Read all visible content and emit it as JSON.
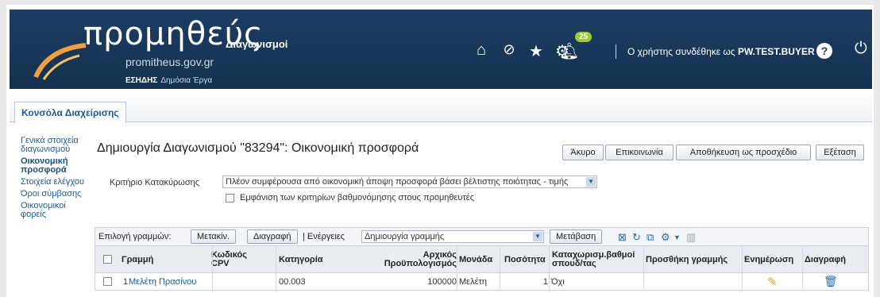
{
  "header": {
    "logo_main": "προμηθεύς",
    "logo_suffix": "Διαγωνισμοί",
    "logo_domain": "promitheus.gov.gr",
    "logo_org": "ΕΣΗΔΗΣ",
    "logo_org_sub": "Δημόσια Έργα",
    "icons": [
      "home-icon",
      "no-entry-icon",
      "star-icon",
      "gear-icon",
      "bell-icon"
    ],
    "notifications": "25",
    "user_prefix": "Ο χρήστης συνδέθηκε ως",
    "user_name": "PW.TEST.BUYER",
    "help": "?",
    "power": "⏻"
  },
  "tabs": {
    "active": "Κονσόλα Διαχείρισης"
  },
  "sidebar": {
    "items": [
      {
        "label": "Γενικά στοιχεία διαγωνισμού"
      },
      {
        "label": "Οικονομική προσφορά"
      },
      {
        "label": "Στοιχεία ελέγχου"
      },
      {
        "label": "Όροι σύμβασης"
      },
      {
        "label": "Οικονομικοί φορείς"
      }
    ]
  },
  "page": {
    "title": "Δημιουργία Διαγωνισμού \"83294\": Οικονομική προσφορά",
    "buttons": {
      "cancel": "Άκυρο",
      "communication": "Επικοινωνία",
      "save_draft": "Αποθήκευση ως προσχέδιο",
      "review": "Εξέταση"
    },
    "criterion_label": "Κριτήριο Κατακύρωσης",
    "criterion_value": "Πλέον συμφέρουσα από οικονομική άποψη προσφορά βάσει βέλτιστης ποιότητας - τιμής",
    "show_criteria_label": "Εμφάνιση των κριτηρίων βαθμονόμησης στους προμηθευτές"
  },
  "toolbar": {
    "select_rows": "Επιλογή γραμμών:",
    "move": "Μετακίν.",
    "delete": "Διαγραφή",
    "actions": "| Ενέργειες",
    "action_value": "Δημιουργία γραμμής",
    "go": "Μετάβαση"
  },
  "table": {
    "columns": [
      "Γραμμή",
      "Κωδικός CPV",
      "Κατηγορία",
      "Αρχικός Προϋπολογισμός",
      "Μονάδα",
      "Ποσότητα",
      "Καταχωρισμ.βαθμοί σπουδ/τας",
      "Προσθήκη γραμμής",
      "Ενημέρωση",
      "Διαγραφή"
    ],
    "rows": [
      {
        "line": "1",
        "name": "Μελέτη Πρασίνου",
        "cpv": "",
        "category": "00.003",
        "budget": "100000",
        "unit": "Μελέτη",
        "qty": "1",
        "scored": "Όχι",
        "add": "",
        "update": "✎",
        "delete": "🗑"
      }
    ]
  }
}
